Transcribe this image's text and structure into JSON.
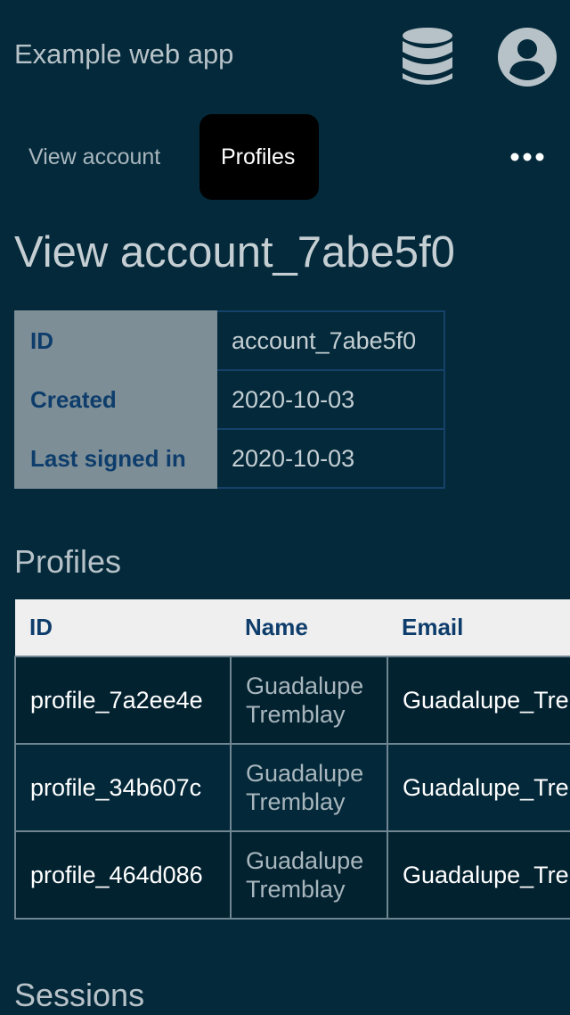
{
  "header": {
    "app_title": "Example web app",
    "icons": [
      "database-icon",
      "user-avatar-icon"
    ]
  },
  "nav": {
    "tabs": [
      {
        "label": "View account",
        "active": false
      },
      {
        "label": "Profiles",
        "active": true
      }
    ],
    "more_icon": "more-horizontal-icon"
  },
  "page": {
    "title": "View account_7abe5f0"
  },
  "account": {
    "rows": [
      {
        "key": "ID",
        "value": "account_7abe5f0"
      },
      {
        "key": "Created",
        "value": "2020-10-03"
      },
      {
        "key": "Last signed in",
        "value": "2020-10-03"
      }
    ]
  },
  "profiles": {
    "title": "Profiles",
    "columns": [
      "ID",
      "Name",
      "Email"
    ],
    "rows": [
      {
        "id": "profile_7a2ee4e",
        "name": "Guadalupe Tremblay",
        "email": "Guadalupe_Tre"
      },
      {
        "id": "profile_34b607c",
        "name": "Guadalupe Tremblay",
        "email": "Guadalupe_Tre"
      },
      {
        "id": "profile_464d086",
        "name": "Guadalupe Tremblay",
        "email": "Guadalupe_Tre"
      }
    ]
  },
  "sessions": {
    "title": "Sessions"
  },
  "colors": {
    "background": "#03293a",
    "active_tab": "#000000",
    "key_cell": "#7d8e96",
    "key_text": "#0e3d6c",
    "table_header": "#efefef"
  }
}
